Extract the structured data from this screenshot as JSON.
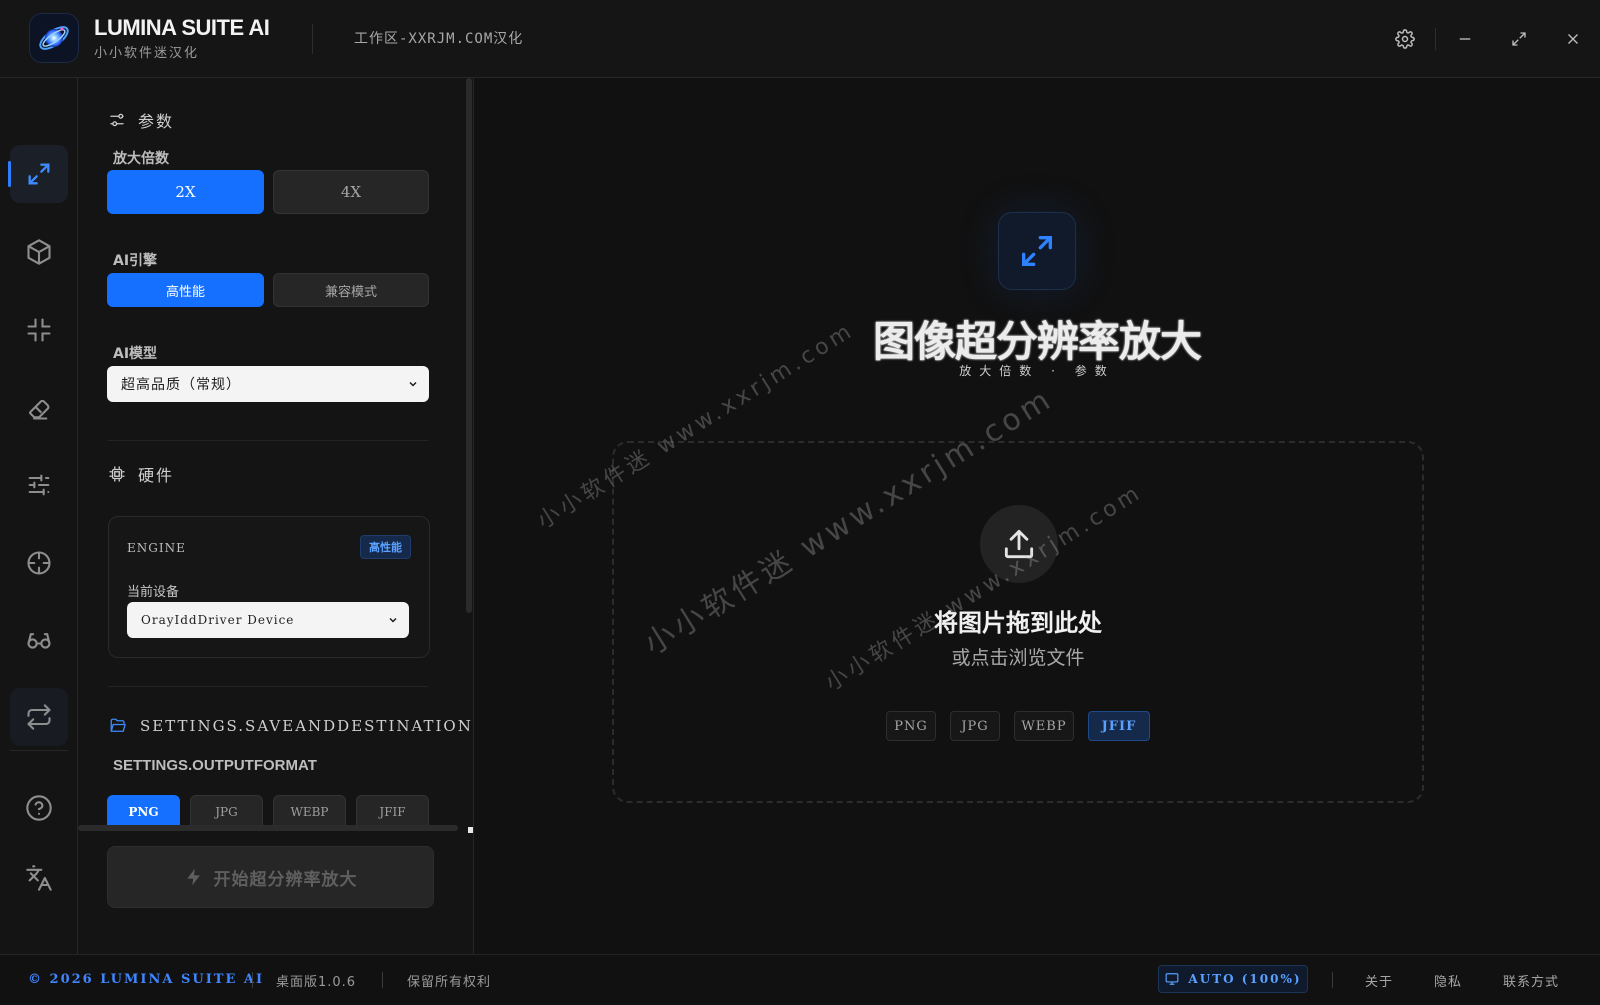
{
  "app": {
    "name": "LUMINA SUITE AI",
    "subname": "小小软件迷汉化",
    "workspace": "工作区-XXRJM.COM汉化"
  },
  "panel": {
    "params_title": "参数",
    "scale_label": "放大倍数",
    "scale_options": [
      "2X",
      "4X"
    ],
    "scale_selected": "2X",
    "engine_label": "AI引擎",
    "engine_options": [
      "高性能",
      "兼容模式"
    ],
    "engine_selected": "高性能",
    "model_label": "AI模型",
    "model_value": "超高品质（常规）",
    "hardware_title": "硬件",
    "hw_engine_label": "ENGINE",
    "hw_engine_badge": "高性能",
    "device_label": "当前设备",
    "device_value": "OrayIddDriver Device",
    "save_title": "SETTINGS.SAVEANDDESTINATION",
    "output_format_label": "SETTINGS.OUTPUTFORMAT",
    "output_formats": [
      "PNG",
      "JPG",
      "WEBP",
      "JFIF"
    ],
    "output_selected": "PNG",
    "start_button": "开始超分辨率放大"
  },
  "main": {
    "title": "图像超分辨率放大",
    "subtitle": "放大倍数 · 参数",
    "drop_title": "将图片拖到此处",
    "drop_sub": "或点击浏览文件",
    "formats": [
      "PNG",
      "JPG",
      "WEBP",
      "JFIF"
    ],
    "format_highlight": "JFIF",
    "watermarks": [
      "小小软件迷 www.xxrjm.com",
      "小小软件迷 www.xxrjm.com",
      "小小软件迷 www.xxrjm.com"
    ]
  },
  "footer": {
    "copyright": "© 2026 LUMINA SUITE AI",
    "version": "桌面版1.0.6",
    "rights": "保留所有权利",
    "display_mode": "AUTO (100%)",
    "about": "关于",
    "privacy": "隐私",
    "contact": "联系方式"
  },
  "colors": {
    "accent": "#1670ff",
    "accent_text": "#5aa0ff",
    "background": "#121212",
    "panel": "#141414"
  },
  "icons": {
    "rail": [
      "upscale-icon",
      "cube-icon",
      "compress-icon",
      "eraser-icon",
      "sliders-icon",
      "crosshair-icon",
      "glasses-icon",
      "convert-icon",
      "help-icon",
      "translate-icon"
    ],
    "window": [
      "gear-icon",
      "minimize-icon",
      "maximize-icon",
      "close-icon"
    ]
  }
}
